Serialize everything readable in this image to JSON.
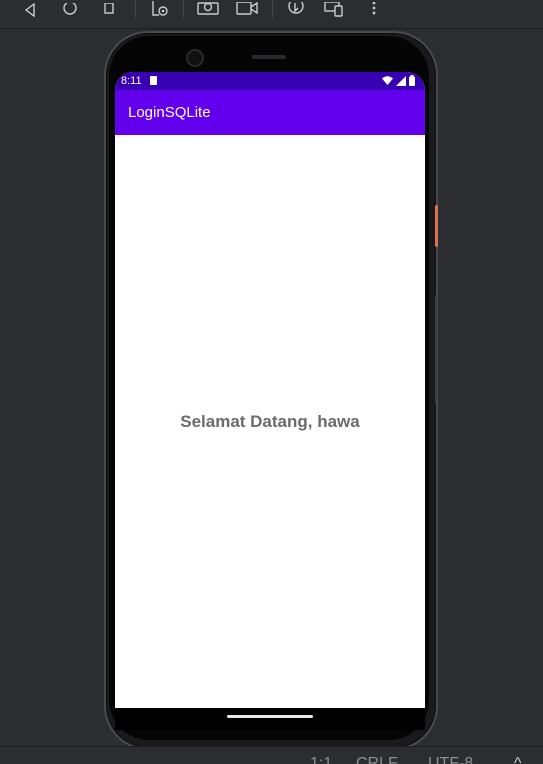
{
  "toolbar": {
    "items": [
      {
        "icon": "back-triangle-icon"
      },
      {
        "icon": "home-circle-icon"
      },
      {
        "icon": "overview-square-icon"
      },
      {
        "icon": "device-settings-icon"
      },
      {
        "icon": "screenshot-camera-icon"
      },
      {
        "icon": "screen-record-icon"
      },
      {
        "icon": "rotate-icon"
      },
      {
        "icon": "device-manager-icon"
      },
      {
        "icon": "more-vertical-icon"
      }
    ]
  },
  "device": {
    "status_bar": {
      "time": "8:11",
      "icons": [
        "sd-card-icon",
        "wifi-icon",
        "signal-icon",
        "battery-icon"
      ]
    },
    "app_bar": {
      "title": "LoginSQLite",
      "color": "#6200ee",
      "status_color": "#3700b3"
    },
    "content": {
      "welcome_text": "Selamat Datang, hawa"
    }
  },
  "ide_status": {
    "position": "1:1",
    "line_separator": "CRLF",
    "encoding": "UTF-8"
  }
}
